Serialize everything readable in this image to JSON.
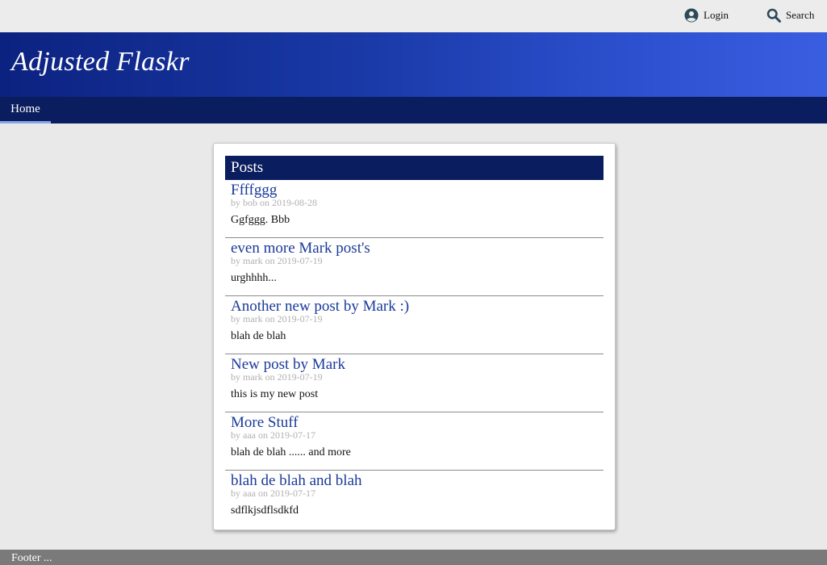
{
  "topbar": {
    "login_label": "Login",
    "search_label": "Search",
    "login_icon": "user-circle-icon",
    "search_icon": "search-icon"
  },
  "header": {
    "brand": "Adjusted Flaskr"
  },
  "nav": {
    "items": [
      {
        "label": "Home",
        "active": true
      }
    ]
  },
  "posts_panel": {
    "title": "Posts",
    "posts": [
      {
        "title": "Ffffggg",
        "meta": "by bob on 2019-08-28",
        "body": "Ggfggg. Bbb"
      },
      {
        "title": "even more Mark post's",
        "meta": "by mark on 2019-07-19",
        "body": "urghhhh..."
      },
      {
        "title": "Another new post by Mark :)",
        "meta": "by mark on 2019-07-19",
        "body": "blah de blah"
      },
      {
        "title": "New post by Mark",
        "meta": "by mark on 2019-07-19",
        "body": "this is my new post"
      },
      {
        "title": "More Stuff",
        "meta": "by aaa on 2019-07-17",
        "body": "blah de blah ...... and more"
      },
      {
        "title": "blah de blah and blah",
        "meta": "by aaa on 2019-07-17",
        "body": "sdflkjsdflsdkfd"
      }
    ]
  },
  "footer": {
    "text": "Footer ..."
  },
  "colors": {
    "nav_bg": "#0a1d5e",
    "banner_start": "#0c2280",
    "banner_end": "#3a5ee0",
    "link": "#1a3a9a",
    "footer_bg": "#7a7a7a"
  }
}
